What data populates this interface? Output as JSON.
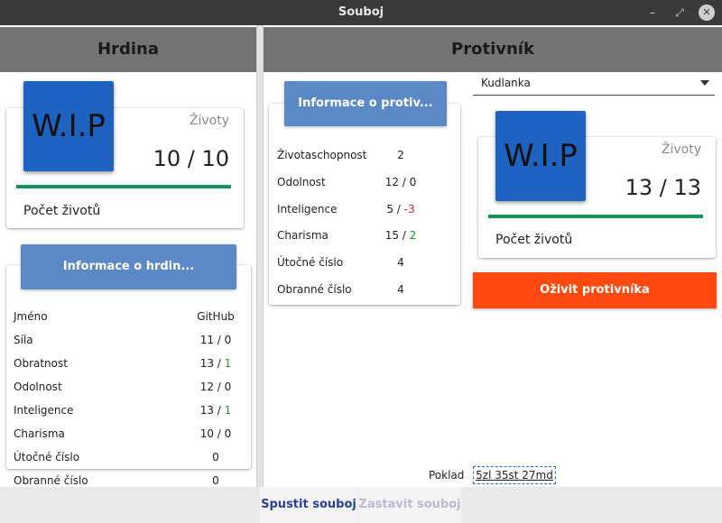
{
  "window": {
    "title": "Souboj"
  },
  "hero": {
    "header": "Hrdina",
    "avatar_text": "W.I.P",
    "hp_label": "Životy",
    "hp_value": "10 / 10",
    "hp_fraction": 1.0,
    "hp_caption": "Počet životů",
    "info_title": "Informace o hrdin...",
    "stats": [
      {
        "name": "Jméno",
        "base": "GitHub",
        "bonus": ""
      },
      {
        "name": "Síla",
        "base": "11 / ",
        "bonus": "0"
      },
      {
        "name": "Obratnost",
        "base": "13 / ",
        "bonus": "1"
      },
      {
        "name": "Odolnost",
        "base": "12 / ",
        "bonus": "0"
      },
      {
        "name": "Inteligence",
        "base": "13 / ",
        "bonus": "1"
      },
      {
        "name": "Charisma",
        "base": "10 / ",
        "bonus": "0"
      },
      {
        "name": "Útočné číslo",
        "base": "0",
        "bonus": ""
      },
      {
        "name": "Obranné číslo",
        "base": "0",
        "bonus": ""
      }
    ]
  },
  "enemy": {
    "header": "Protivník",
    "selected": "Kudlanka",
    "avatar_text": "W.I.P",
    "hp_label": "Životy",
    "hp_value": "13 / 13",
    "hp_fraction": 1.0,
    "hp_caption": "Počet životů",
    "info_title": "Informace o protiv...",
    "stats": [
      {
        "name": "Životaschopnost",
        "base": "2",
        "bonus": ""
      },
      {
        "name": "Odolnost",
        "base": "12 / ",
        "bonus": "0"
      },
      {
        "name": "Inteligence",
        "base": "5 / ",
        "bonus": "-3"
      },
      {
        "name": "Charisma",
        "base": "15 / ",
        "bonus": "2"
      },
      {
        "name": "Útočné číslo",
        "base": "4",
        "bonus": ""
      },
      {
        "name": "Obranné číslo",
        "base": "4",
        "bonus": ""
      }
    ],
    "revive_label": "Oživit protivníka",
    "loot_label": "Poklad",
    "loot_value": "5zl 35st 27md"
  },
  "footer": {
    "start_label": "Spustit souboj",
    "stop_label": "Zastavit souboj"
  },
  "colors": {
    "hp_bar": "#14935a",
    "bonus_positive": "#1b9a2a",
    "bonus_negative": "#e02424",
    "revive_button": "#ff4a0f",
    "avatar": "#1f63c2"
  }
}
